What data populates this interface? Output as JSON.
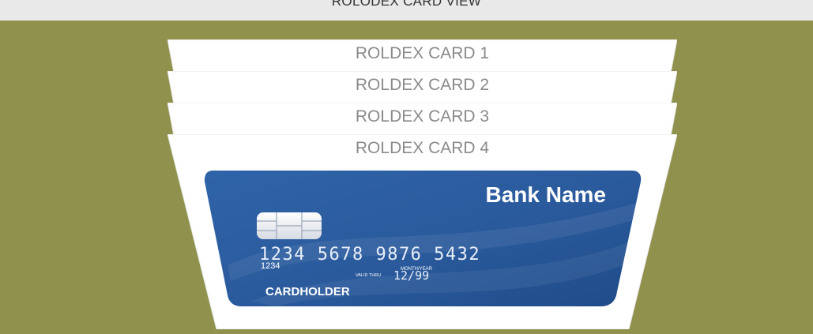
{
  "header": {
    "title": "ROLODEX CARD VIEW"
  },
  "cards": [
    {
      "label": "ROLDEX CARD 1"
    },
    {
      "label": "ROLDEX CARD 2"
    },
    {
      "label": "ROLDEX CARD 3"
    },
    {
      "label": "ROLDEX CARD 4"
    }
  ],
  "credit_card": {
    "bank_name": "Bank Name",
    "number": "1234 5678 9876 5432",
    "number_small": "1234",
    "valid_thru_label": "VALID THRU",
    "month_year_label": "MONTH/YEAR",
    "expiry": "12/99",
    "holder": "CARDHOLDER"
  },
  "colors": {
    "background": "#8f914c",
    "header": "#e9e9e9",
    "card": "#ffffff",
    "credit_card": "#2a5a9c"
  }
}
